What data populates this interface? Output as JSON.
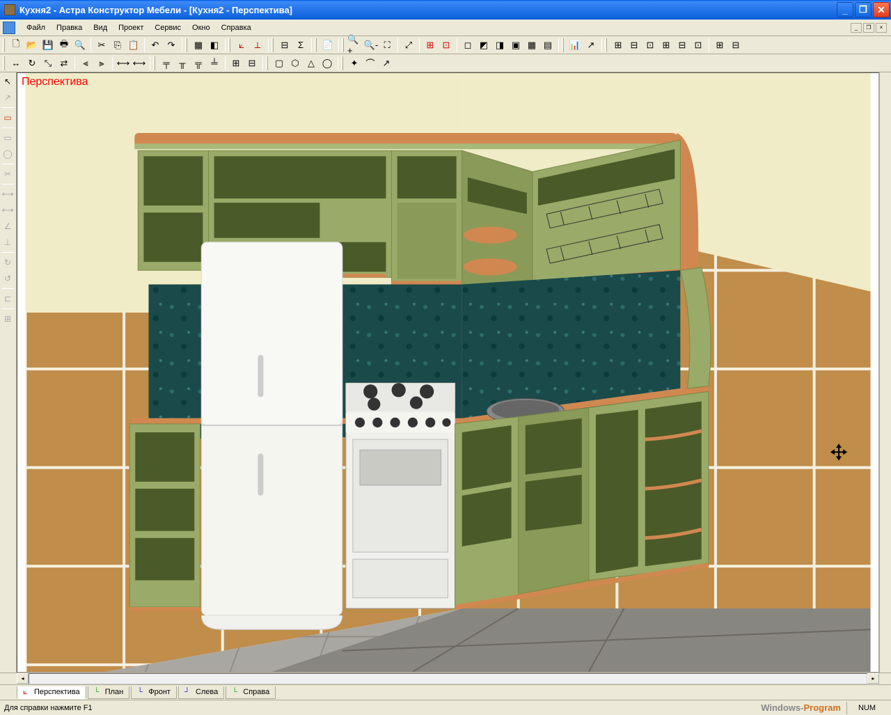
{
  "window": {
    "title": "Кухня2 - Астра Конструктор Мебели - [Кухня2 - Перспектива]"
  },
  "menu": {
    "items": [
      "Файл",
      "Правка",
      "Вид",
      "Проект",
      "Сервис",
      "Окно",
      "Справка"
    ]
  },
  "viewport": {
    "label": "Перспектива"
  },
  "viewtabs": [
    {
      "label": "Перспектива",
      "active": true,
      "color": "#d02020"
    },
    {
      "label": "План",
      "active": false,
      "color": "#20a020"
    },
    {
      "label": "Фронт",
      "active": false,
      "color": "#2020d0"
    },
    {
      "label": "Слева",
      "active": false,
      "color": "#2020d0"
    },
    {
      "label": "Справа",
      "active": false,
      "color": "#20a020"
    }
  ],
  "statusbar": {
    "help": "Для справки нажмите F1",
    "watermark1": "Windows-",
    "watermark2": "Program",
    "num": "NUM"
  }
}
